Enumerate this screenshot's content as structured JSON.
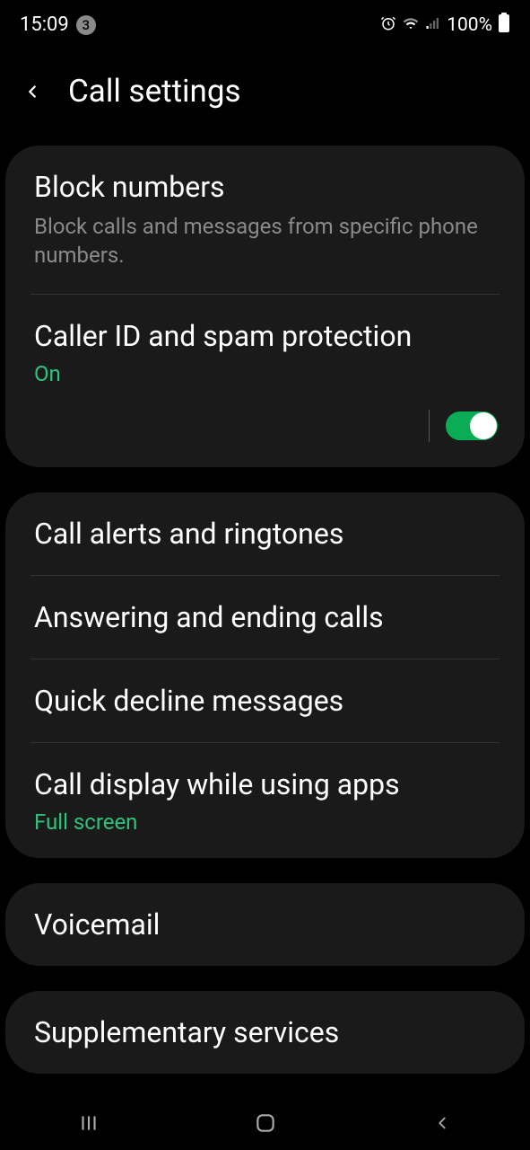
{
  "status": {
    "time": "15:09",
    "notif_count": "3",
    "battery": "100%"
  },
  "header": {
    "title": "Call settings"
  },
  "groups": [
    {
      "items": [
        {
          "title": "Block numbers",
          "subtitle": "Block calls and messages from specific phone numbers."
        },
        {
          "title": "Caller ID and spam protection",
          "status": "On",
          "toggle": true
        }
      ]
    },
    {
      "items": [
        {
          "title": "Call alerts and ringtones"
        },
        {
          "title": "Answering and ending calls"
        },
        {
          "title": "Quick decline messages"
        },
        {
          "title": "Call display while using apps",
          "status": "Full screen"
        }
      ]
    },
    {
      "items": [
        {
          "title": "Voicemail"
        }
      ]
    },
    {
      "items": [
        {
          "title": "Supplementary services"
        }
      ]
    }
  ]
}
